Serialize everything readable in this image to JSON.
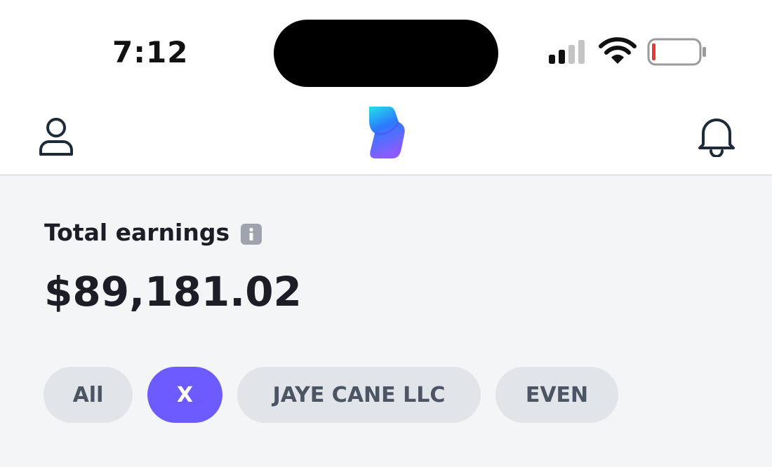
{
  "status_bar": {
    "time": "7:12",
    "battery_level": 0.05,
    "low_battery_color": "#e53935"
  },
  "nav": {
    "profile_icon": "person-outline-icon",
    "logo_icon": "app-logo-gradient-icon",
    "notifications_icon": "bell-outline-icon",
    "logo_colors": [
      "#22e1e6",
      "#2b7bff",
      "#8a5cff"
    ]
  },
  "earnings": {
    "label": "Total earnings",
    "info_icon": "info-icon",
    "amount": "$89,181.02"
  },
  "filters": {
    "chips": [
      {
        "label": "All",
        "active": false
      },
      {
        "label": "X",
        "active": true
      },
      {
        "label": "JAYE CANE LLC",
        "active": false
      },
      {
        "label": "EVEN",
        "active": false
      }
    ],
    "active_color": "#6c5cff"
  }
}
